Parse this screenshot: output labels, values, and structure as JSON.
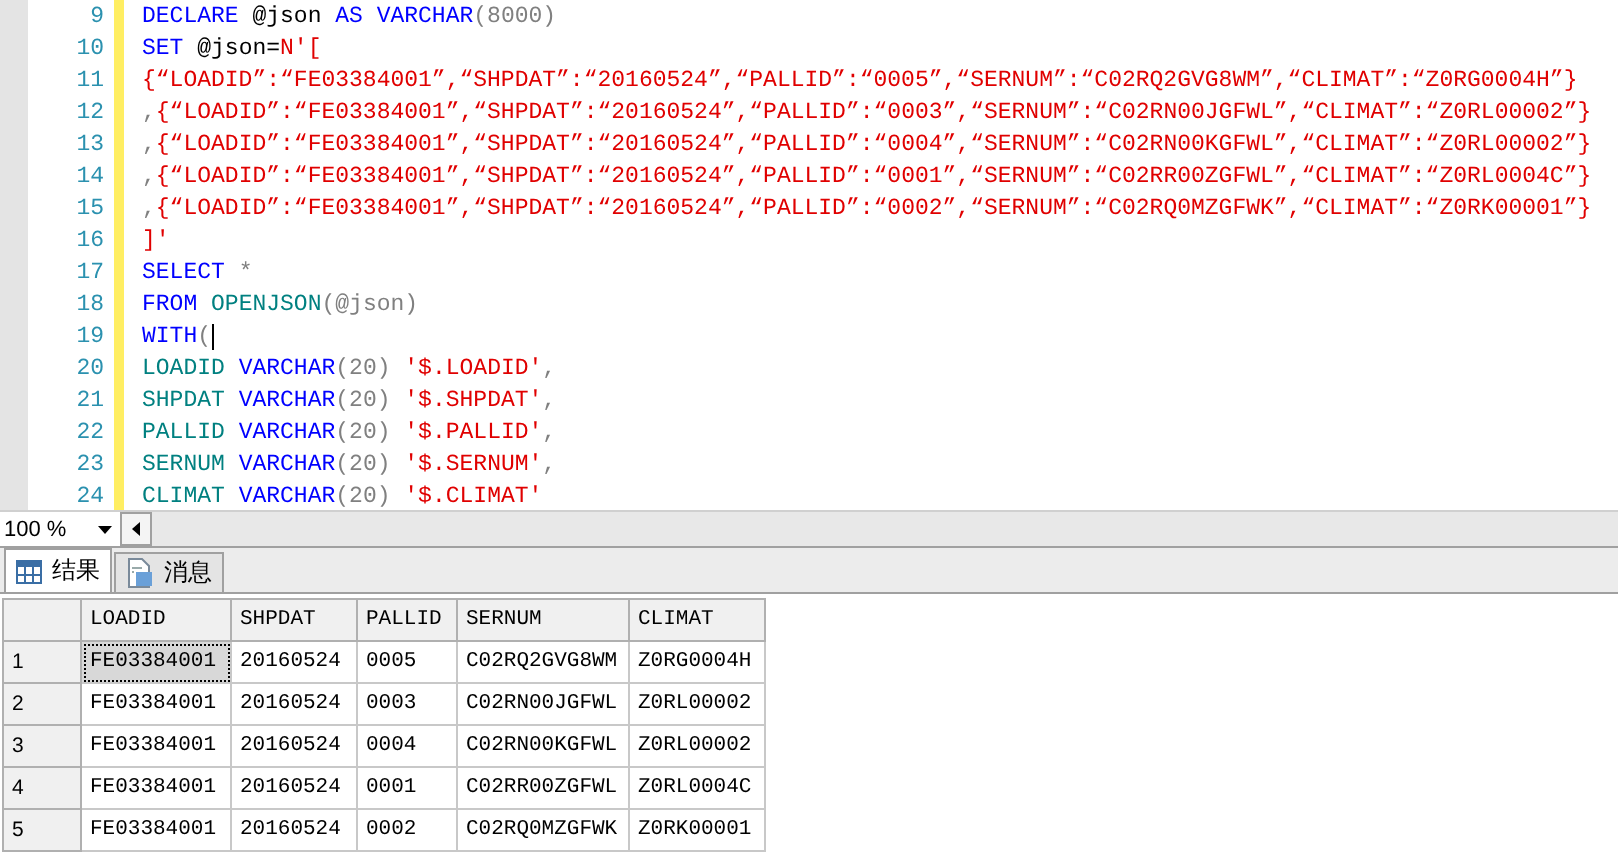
{
  "editor": {
    "lines": [
      {
        "num": "9",
        "tokens": [
          {
            "kind": "keyword",
            "text": "DECLARE"
          },
          {
            "kind": "plain",
            "text": " @json "
          },
          {
            "kind": "keyword",
            "text": "AS VARCHAR"
          },
          {
            "kind": "op",
            "text": "(8000)"
          }
        ]
      },
      {
        "num": "10",
        "tokens": [
          {
            "kind": "keyword",
            "text": "SET"
          },
          {
            "kind": "plain",
            "text": " @json="
          },
          {
            "kind": "string",
            "text": "N'["
          }
        ]
      },
      {
        "num": "11",
        "tokens": [
          {
            "kind": "string",
            "text": "{“LOADID”:“FE03384001”,“SHPDAT”:“20160524”,“PALLID”:“0005”,“SERNUM”:“C02RQ2GVG8WM”,“CLIMAT”:“Z0RG0004H”}"
          }
        ]
      },
      {
        "num": "12",
        "tokens": [
          {
            "kind": "op",
            "text": ","
          },
          {
            "kind": "string",
            "text": "{“LOADID”:“FE03384001”,“SHPDAT”:“20160524”,“PALLID”:“0003”,“SERNUM”:“C02RN00JGFWL”,“CLIMAT”:“Z0RL00002”}"
          }
        ]
      },
      {
        "num": "13",
        "tokens": [
          {
            "kind": "op",
            "text": ","
          },
          {
            "kind": "string",
            "text": "{“LOADID”:“FE03384001”,“SHPDAT”:“20160524”,“PALLID”:“0004”,“SERNUM”:“C02RN00KGFWL”,“CLIMAT”:“Z0RL00002”}"
          }
        ]
      },
      {
        "num": "14",
        "tokens": [
          {
            "kind": "op",
            "text": ","
          },
          {
            "kind": "string",
            "text": "{“LOADID”:“FE03384001”,“SHPDAT”:“20160524”,“PALLID”:“0001”,“SERNUM”:“C02RR00ZGFWL”,“CLIMAT”:“Z0RL0004C”}"
          }
        ]
      },
      {
        "num": "15",
        "tokens": [
          {
            "kind": "op",
            "text": ","
          },
          {
            "kind": "string",
            "text": "{“LOADID”:“FE03384001”,“SHPDAT”:“20160524”,“PALLID”:“0002”,“SERNUM”:“C02RQ0MZGFWK”,“CLIMAT”:“Z0RK00001”}"
          }
        ]
      },
      {
        "num": "16",
        "tokens": [
          {
            "kind": "string",
            "text": "]'"
          }
        ]
      },
      {
        "num": "17",
        "tokens": [
          {
            "kind": "keyword",
            "text": "SELECT"
          },
          {
            "kind": "op",
            "text": " *"
          }
        ]
      },
      {
        "num": "18",
        "tokens": [
          {
            "kind": "keyword",
            "text": "FROM"
          },
          {
            "kind": "function",
            "text": " OPENJSON"
          },
          {
            "kind": "op",
            "text": "(@json)"
          }
        ]
      },
      {
        "num": "19",
        "cursor": true,
        "tokens": [
          {
            "kind": "keyword",
            "text": "WITH"
          },
          {
            "kind": "op",
            "text": "("
          }
        ]
      },
      {
        "num": "20",
        "tokens": [
          {
            "kind": "function",
            "text": "LOADID"
          },
          {
            "kind": "keyword",
            "text": " VARCHAR"
          },
          {
            "kind": "op",
            "text": "(20) "
          },
          {
            "kind": "string",
            "text": "'$.LOADID'"
          },
          {
            "kind": "op",
            "text": ","
          }
        ]
      },
      {
        "num": "21",
        "tokens": [
          {
            "kind": "function",
            "text": "SHPDAT"
          },
          {
            "kind": "keyword",
            "text": " VARCHAR"
          },
          {
            "kind": "op",
            "text": "(20) "
          },
          {
            "kind": "string",
            "text": "'$.SHPDAT'"
          },
          {
            "kind": "op",
            "text": ","
          }
        ]
      },
      {
        "num": "22",
        "tokens": [
          {
            "kind": "function",
            "text": "PALLID"
          },
          {
            "kind": "keyword",
            "text": " VARCHAR"
          },
          {
            "kind": "op",
            "text": "(20) "
          },
          {
            "kind": "string",
            "text": "'$.PALLID'"
          },
          {
            "kind": "op",
            "text": ","
          }
        ]
      },
      {
        "num": "23",
        "tokens": [
          {
            "kind": "function",
            "text": "SERNUM"
          },
          {
            "kind": "keyword",
            "text": " VARCHAR"
          },
          {
            "kind": "op",
            "text": "(20) "
          },
          {
            "kind": "string",
            "text": "'$.SERNUM'"
          },
          {
            "kind": "op",
            "text": ","
          }
        ]
      },
      {
        "num": "24",
        "tokens": [
          {
            "kind": "function",
            "text": "CLIMAT"
          },
          {
            "kind": "keyword",
            "text": " VARCHAR"
          },
          {
            "kind": "op",
            "text": "(20) "
          },
          {
            "kind": "string",
            "text": "'$.CLIMAT'"
          }
        ]
      }
    ]
  },
  "zoom": {
    "value": "100 %"
  },
  "tabs": [
    {
      "label": "结果",
      "kind": "grid",
      "selected": true
    },
    {
      "label": "消息",
      "kind": "doc",
      "selected": false
    }
  ],
  "table": {
    "columns": [
      "LOADID",
      "SHPDAT",
      "PALLID",
      "SERNUM",
      "CLIMAT"
    ],
    "rows": [
      {
        "num": "1",
        "cells": [
          {
            "text": "FE03384001",
            "selected": true
          },
          {
            "text": "20160524",
            "selected": false
          },
          {
            "text": "0005",
            "selected": false
          },
          {
            "text": "C02RQ2GVG8WM",
            "selected": false
          },
          {
            "text": "Z0RG0004H",
            "selected": false
          }
        ]
      },
      {
        "num": "2",
        "cells": [
          {
            "text": "FE03384001",
            "selected": false
          },
          {
            "text": "20160524",
            "selected": false
          },
          {
            "text": "0003",
            "selected": false
          },
          {
            "text": "C02RN00JGFWL",
            "selected": false
          },
          {
            "text": "Z0RL00002",
            "selected": false
          }
        ]
      },
      {
        "num": "3",
        "cells": [
          {
            "text": "FE03384001",
            "selected": false
          },
          {
            "text": "20160524",
            "selected": false
          },
          {
            "text": "0004",
            "selected": false
          },
          {
            "text": "C02RN00KGFWL",
            "selected": false
          },
          {
            "text": "Z0RL00002",
            "selected": false
          }
        ]
      },
      {
        "num": "4",
        "cells": [
          {
            "text": "FE03384001",
            "selected": false
          },
          {
            "text": "20160524",
            "selected": false
          },
          {
            "text": "0001",
            "selected": false
          },
          {
            "text": "C02RR00ZGFWL",
            "selected": false
          },
          {
            "text": "Z0RL0004C",
            "selected": false
          }
        ]
      },
      {
        "num": "5",
        "cells": [
          {
            "text": "FE03384001",
            "selected": false
          },
          {
            "text": "20160524",
            "selected": false
          },
          {
            "text": "0002",
            "selected": false
          },
          {
            "text": "C02RQ0MZGFWK",
            "selected": false
          },
          {
            "text": "Z0RK00001",
            "selected": false
          }
        ]
      }
    ]
  }
}
